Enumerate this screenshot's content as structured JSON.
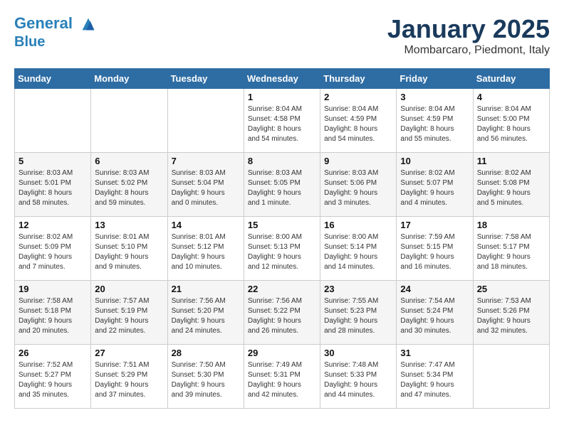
{
  "header": {
    "logo_line1": "General",
    "logo_line2": "Blue",
    "month_title": "January 2025",
    "location": "Mombarcaro, Piedmont, Italy"
  },
  "weekdays": [
    "Sunday",
    "Monday",
    "Tuesday",
    "Wednesday",
    "Thursday",
    "Friday",
    "Saturday"
  ],
  "weeks": [
    [
      {
        "day": "",
        "info": ""
      },
      {
        "day": "",
        "info": ""
      },
      {
        "day": "",
        "info": ""
      },
      {
        "day": "1",
        "info": "Sunrise: 8:04 AM\nSunset: 4:58 PM\nDaylight: 8 hours\nand 54 minutes."
      },
      {
        "day": "2",
        "info": "Sunrise: 8:04 AM\nSunset: 4:59 PM\nDaylight: 8 hours\nand 54 minutes."
      },
      {
        "day": "3",
        "info": "Sunrise: 8:04 AM\nSunset: 4:59 PM\nDaylight: 8 hours\nand 55 minutes."
      },
      {
        "day": "4",
        "info": "Sunrise: 8:04 AM\nSunset: 5:00 PM\nDaylight: 8 hours\nand 56 minutes."
      }
    ],
    [
      {
        "day": "5",
        "info": "Sunrise: 8:03 AM\nSunset: 5:01 PM\nDaylight: 8 hours\nand 58 minutes."
      },
      {
        "day": "6",
        "info": "Sunrise: 8:03 AM\nSunset: 5:02 PM\nDaylight: 8 hours\nand 59 minutes."
      },
      {
        "day": "7",
        "info": "Sunrise: 8:03 AM\nSunset: 5:04 PM\nDaylight: 9 hours\nand 0 minutes."
      },
      {
        "day": "8",
        "info": "Sunrise: 8:03 AM\nSunset: 5:05 PM\nDaylight: 9 hours\nand 1 minute."
      },
      {
        "day": "9",
        "info": "Sunrise: 8:03 AM\nSunset: 5:06 PM\nDaylight: 9 hours\nand 3 minutes."
      },
      {
        "day": "10",
        "info": "Sunrise: 8:02 AM\nSunset: 5:07 PM\nDaylight: 9 hours\nand 4 minutes."
      },
      {
        "day": "11",
        "info": "Sunrise: 8:02 AM\nSunset: 5:08 PM\nDaylight: 9 hours\nand 5 minutes."
      }
    ],
    [
      {
        "day": "12",
        "info": "Sunrise: 8:02 AM\nSunset: 5:09 PM\nDaylight: 9 hours\nand 7 minutes."
      },
      {
        "day": "13",
        "info": "Sunrise: 8:01 AM\nSunset: 5:10 PM\nDaylight: 9 hours\nand 9 minutes."
      },
      {
        "day": "14",
        "info": "Sunrise: 8:01 AM\nSunset: 5:12 PM\nDaylight: 9 hours\nand 10 minutes."
      },
      {
        "day": "15",
        "info": "Sunrise: 8:00 AM\nSunset: 5:13 PM\nDaylight: 9 hours\nand 12 minutes."
      },
      {
        "day": "16",
        "info": "Sunrise: 8:00 AM\nSunset: 5:14 PM\nDaylight: 9 hours\nand 14 minutes."
      },
      {
        "day": "17",
        "info": "Sunrise: 7:59 AM\nSunset: 5:15 PM\nDaylight: 9 hours\nand 16 minutes."
      },
      {
        "day": "18",
        "info": "Sunrise: 7:58 AM\nSunset: 5:17 PM\nDaylight: 9 hours\nand 18 minutes."
      }
    ],
    [
      {
        "day": "19",
        "info": "Sunrise: 7:58 AM\nSunset: 5:18 PM\nDaylight: 9 hours\nand 20 minutes."
      },
      {
        "day": "20",
        "info": "Sunrise: 7:57 AM\nSunset: 5:19 PM\nDaylight: 9 hours\nand 22 minutes."
      },
      {
        "day": "21",
        "info": "Sunrise: 7:56 AM\nSunset: 5:20 PM\nDaylight: 9 hours\nand 24 minutes."
      },
      {
        "day": "22",
        "info": "Sunrise: 7:56 AM\nSunset: 5:22 PM\nDaylight: 9 hours\nand 26 minutes."
      },
      {
        "day": "23",
        "info": "Sunrise: 7:55 AM\nSunset: 5:23 PM\nDaylight: 9 hours\nand 28 minutes."
      },
      {
        "day": "24",
        "info": "Sunrise: 7:54 AM\nSunset: 5:24 PM\nDaylight: 9 hours\nand 30 minutes."
      },
      {
        "day": "25",
        "info": "Sunrise: 7:53 AM\nSunset: 5:26 PM\nDaylight: 9 hours\nand 32 minutes."
      }
    ],
    [
      {
        "day": "26",
        "info": "Sunrise: 7:52 AM\nSunset: 5:27 PM\nDaylight: 9 hours\nand 35 minutes."
      },
      {
        "day": "27",
        "info": "Sunrise: 7:51 AM\nSunset: 5:29 PM\nDaylight: 9 hours\nand 37 minutes."
      },
      {
        "day": "28",
        "info": "Sunrise: 7:50 AM\nSunset: 5:30 PM\nDaylight: 9 hours\nand 39 minutes."
      },
      {
        "day": "29",
        "info": "Sunrise: 7:49 AM\nSunset: 5:31 PM\nDaylight: 9 hours\nand 42 minutes."
      },
      {
        "day": "30",
        "info": "Sunrise: 7:48 AM\nSunset: 5:33 PM\nDaylight: 9 hours\nand 44 minutes."
      },
      {
        "day": "31",
        "info": "Sunrise: 7:47 AM\nSunset: 5:34 PM\nDaylight: 9 hours\nand 47 minutes."
      },
      {
        "day": "",
        "info": ""
      }
    ]
  ]
}
